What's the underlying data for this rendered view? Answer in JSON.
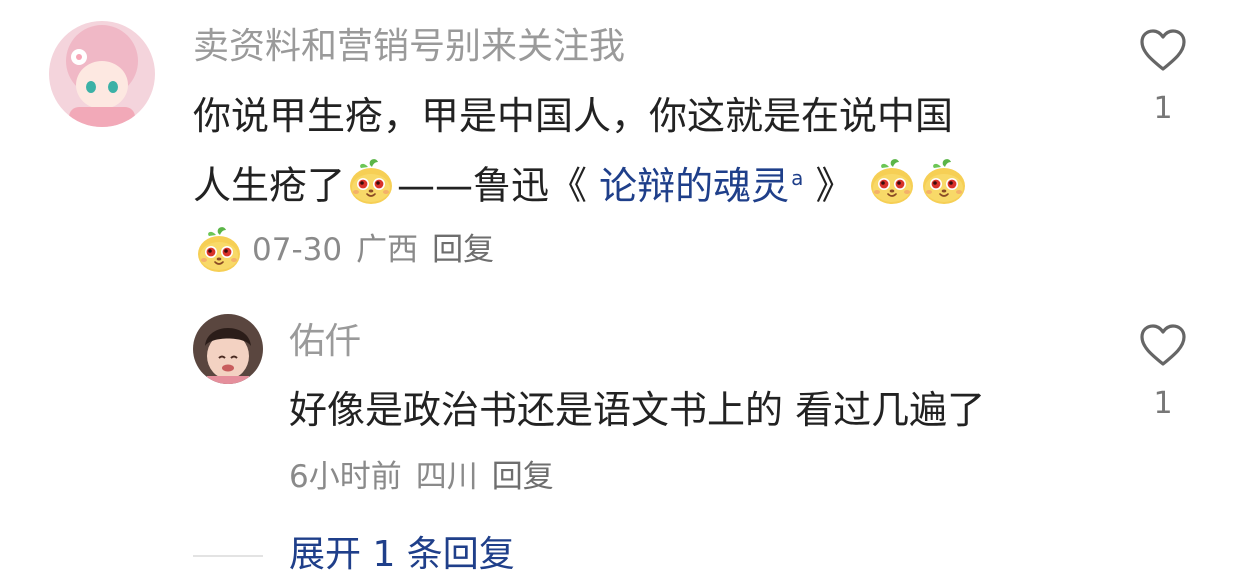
{
  "comment": {
    "username": "卖资料和营销号别来关注我",
    "lines": {
      "line1": "你说甲生疮，甲是中国人，你这就是在说中国",
      "line2_prefix": "人生疮了",
      "line2_dash": "——鲁迅《",
      "link_text": "论辩的魂灵",
      "line2_suffix": "》"
    },
    "meta": {
      "date": "07-30",
      "location": "广西",
      "reply_label": "回复"
    },
    "likes": "1",
    "emoji_name": "smirk-sticker-icon"
  },
  "reply": {
    "username": "佑仟",
    "text": "好像是政治书还是语文书上的 看过几遍了",
    "meta": {
      "time": "6小时前",
      "location": "四川",
      "reply_label": "回复"
    },
    "likes": "1"
  },
  "expand_label": "展开 1 条回复",
  "colors": {
    "link": "#1f3f8a",
    "username": "#9a9a9a",
    "body": "#222222",
    "meta": "#8a8a8a"
  }
}
